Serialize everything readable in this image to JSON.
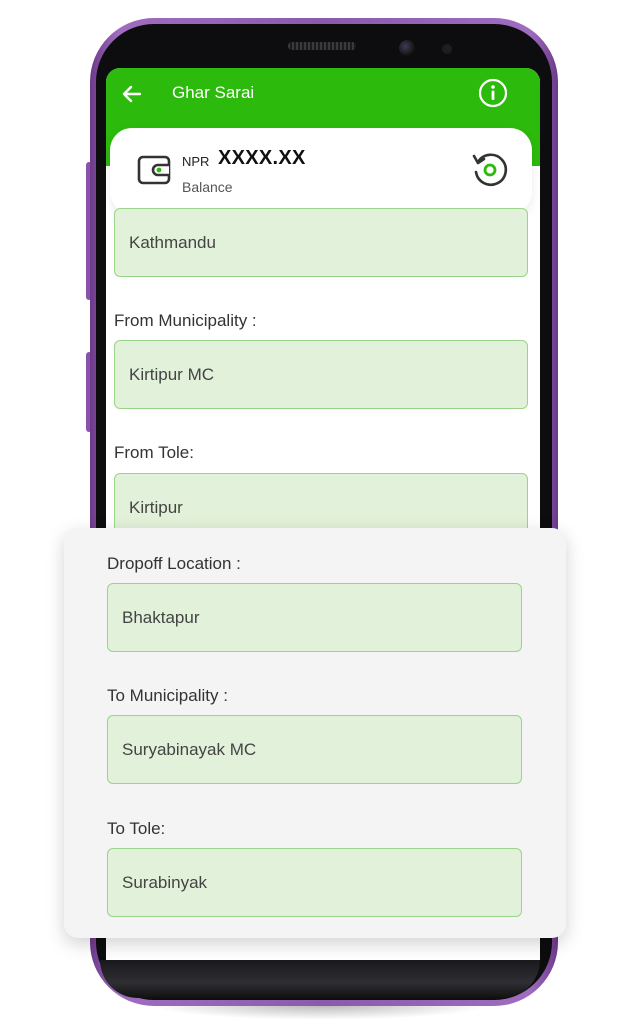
{
  "app": {
    "title": "Ghar Sarai",
    "back_icon": "arrow-left-icon",
    "info_icon": "info-icon"
  },
  "balance": {
    "currency": "NPR",
    "amount": "XXXX.XX",
    "label": "Balance",
    "wallet_icon": "wallet-icon",
    "refresh_icon": "refresh-icon"
  },
  "form": {
    "from_district_value": "Kathmandu",
    "from_municipality_label": "From Municipality :",
    "from_municipality_value": "Kirtipur MC",
    "from_tole_label": "From Tole:",
    "from_tole_value": "Kirtipur",
    "dropoff_label": "Dropoff Location :",
    "dropoff_value": "Bhaktapur",
    "to_municipality_label": "To Municipality :",
    "to_municipality_value": "Suryabinayak MC",
    "to_tole_label": "To Tole:",
    "to_tole_value": "Surabinyak"
  },
  "colors": {
    "header_green": "#2cba0c",
    "field_fill": "#e2f1d9",
    "field_border": "#9ad48a",
    "phone_frame": "#8c5aab"
  }
}
